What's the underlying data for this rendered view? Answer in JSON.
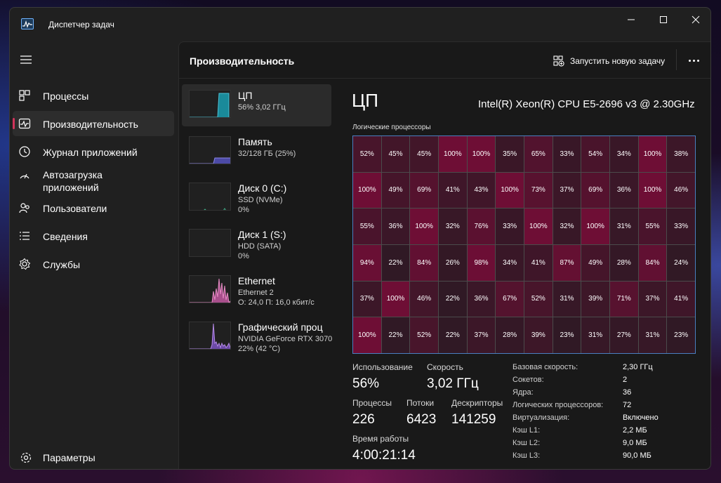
{
  "window": {
    "title": "Диспетчер задач"
  },
  "sidebar": {
    "items": [
      {
        "label": "Процессы",
        "icon": "processes-icon"
      },
      {
        "label": "Производительность",
        "icon": "performance-icon",
        "active": true
      },
      {
        "label": "Журнал приложений",
        "icon": "app-history-icon"
      },
      {
        "label": "Автозагрузка приложений",
        "icon": "startup-icon"
      },
      {
        "label": "Пользователи",
        "icon": "users-icon"
      },
      {
        "label": "Сведения",
        "icon": "details-icon"
      },
      {
        "label": "Службы",
        "icon": "services-icon"
      }
    ],
    "settings_label": "Параметры"
  },
  "header": {
    "title": "Производительность",
    "run_task_label": "Запустить новую задачу"
  },
  "devices": [
    {
      "name": "ЦП",
      "line1": "56% 3,02 ГГц",
      "line2": "",
      "color": "#4cc2d6"
    },
    {
      "name": "Память",
      "line1": "32/128 ГБ (25%)",
      "line2": "",
      "color": "#8a86e6"
    },
    {
      "name": "Диск 0 (C:)",
      "line1": "SSD (NVMe)",
      "line2": "0%",
      "color": "#3fb08a"
    },
    {
      "name": "Диск 1 (S:)",
      "line1": "HDD (SATA)",
      "line2": "0%",
      "color": "#3fb08a"
    },
    {
      "name": "Ethernet",
      "line1": "Ethernet 2",
      "line2": "О: 24,0 П: 16,0 кбит/с",
      "color": "#e68ac4"
    },
    {
      "name": "Графический проц",
      "line1": "NVIDIA GeForce RTX 3070",
      "line2": "22% (42 °C)",
      "color": "#b58ae6"
    }
  ],
  "cpu": {
    "title": "ЦП",
    "model": "Intel(R) Xeon(R) CPU E5-2696 v3 @ 2.30GHz",
    "grid_label": "Логические процессоры",
    "logical_usage": [
      [
        "52%",
        "45%",
        "45%",
        "100%",
        "100%",
        "35%",
        "65%",
        "33%",
        "54%",
        "34%",
        "100%",
        "38%"
      ],
      [
        "100%",
        "49%",
        "69%",
        "41%",
        "43%",
        "100%",
        "73%",
        "37%",
        "69%",
        "36%",
        "100%",
        "46%"
      ],
      [
        "55%",
        "36%",
        "100%",
        "32%",
        "76%",
        "33%",
        "100%",
        "32%",
        "100%",
        "31%",
        "55%",
        "33%"
      ],
      [
        "94%",
        "22%",
        "84%",
        "26%",
        "98%",
        "34%",
        "41%",
        "87%",
        "49%",
        "28%",
        "84%",
        "24%"
      ],
      [
        "37%",
        "100%",
        "46%",
        "22%",
        "36%",
        "67%",
        "52%",
        "31%",
        "39%",
        "71%",
        "37%",
        "41%"
      ],
      [
        "100%",
        "22%",
        "52%",
        "22%",
        "37%",
        "28%",
        "39%",
        "23%",
        "31%",
        "27%",
        "31%",
        "23%"
      ]
    ],
    "stats": {
      "usage_label": "Использование",
      "usage": "56%",
      "speed_label": "Скорость",
      "speed": "3,02 ГГц",
      "processes_label": "Процессы",
      "processes": "226",
      "threads_label": "Потоки",
      "threads": "6423",
      "handles_label": "Дескрипторы",
      "handles": "141259",
      "uptime_label": "Время работы",
      "uptime": "4:00:21:14"
    },
    "specs": [
      {
        "key": "Базовая скорость:",
        "value": "2,30 ГГц"
      },
      {
        "key": "Сокетов:",
        "value": "2"
      },
      {
        "key": "Ядра:",
        "value": "36"
      },
      {
        "key": "Логических процессоров:",
        "value": "72"
      },
      {
        "key": "Виртуализация:",
        "value": "Включено"
      },
      {
        "key": "Кэш L1:",
        "value": "2,2 МБ"
      },
      {
        "key": "Кэш L2:",
        "value": "9,0 МБ"
      },
      {
        "key": "Кэш L3:",
        "value": "90,0 МБ"
      }
    ]
  },
  "colors": {
    "accent": "#d1345b",
    "grid_border": "#4a7fc1",
    "cell_high": "#6e0e35"
  }
}
